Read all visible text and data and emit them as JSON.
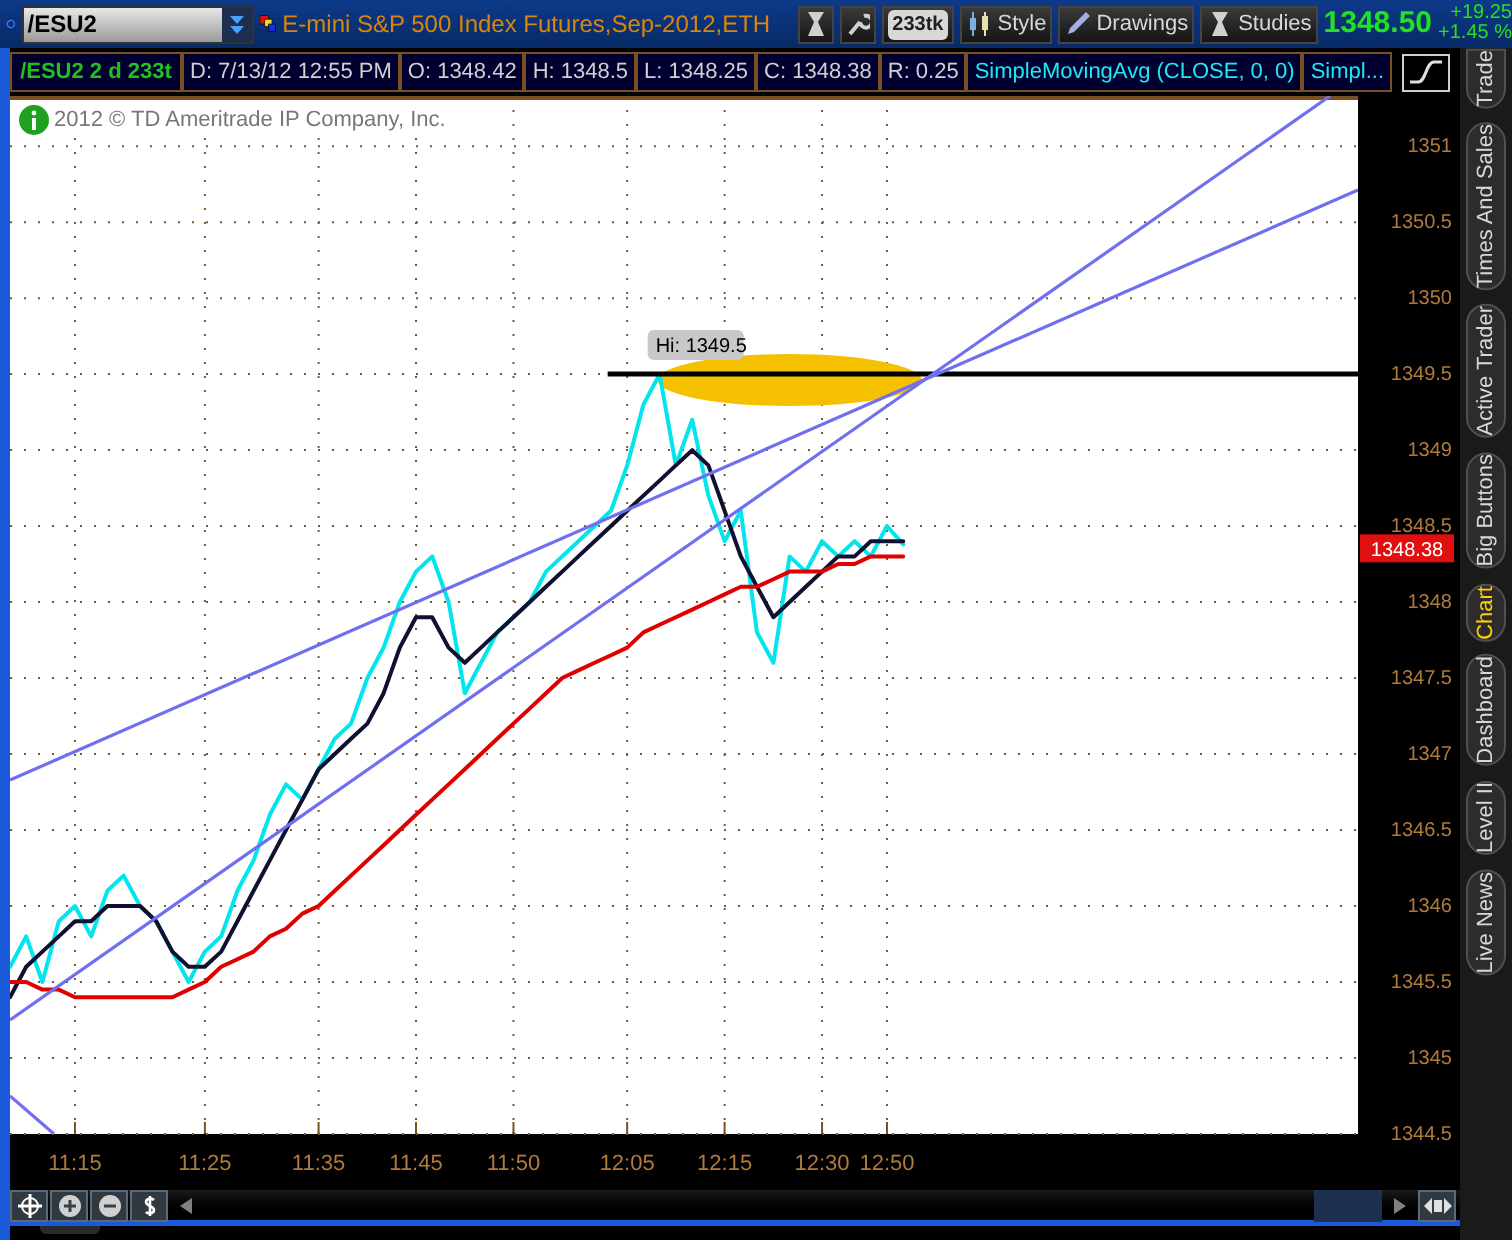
{
  "header": {
    "symbol": "/ESU2",
    "title": "E-mini S&P 500 Index Futures,Sep-2012,ETH",
    "aggregation": "233tk",
    "buttons": [
      "Style",
      "Drawings",
      "Studies"
    ],
    "last": "1348.50",
    "change": "+19.25",
    "change_pct": "+1.45 %"
  },
  "info_bar": {
    "symbol_period": "/ESU2 2 d 233t",
    "fields": [
      "D: 7/13/12 12:55 PM",
      "O: 1348.42",
      "H: 1348.5",
      "L: 1348.25",
      "C: 1348.38",
      "R: 0.25"
    ],
    "studies": [
      "SimpleMovingAvg (CLOSE, 0, 0)",
      "Simpl..."
    ]
  },
  "chart": {
    "copyright": "2012 © TD Ameritrade IP Company, Inc.",
    "chart_data": {
      "type": "line",
      "categories": [
        null,
        null,
        null,
        null,
        "11:15",
        null,
        null,
        null,
        null,
        null,
        null,
        null,
        "11:25",
        null,
        null,
        null,
        null,
        null,
        null,
        "11:35",
        null,
        null,
        null,
        null,
        null,
        "11:45",
        null,
        null,
        null,
        null,
        null,
        "11:50",
        null,
        null,
        null,
        null,
        null,
        null,
        "12:05",
        null,
        null,
        null,
        null,
        null,
        "12:15",
        null,
        null,
        null,
        null,
        null,
        "12:30",
        null,
        null,
        null,
        "12:50",
        null
      ],
      "ylim": [
        1344.5,
        1351.33
      ],
      "yticks": [
        1344.5,
        1345,
        1345.5,
        1346,
        1346.5,
        1347,
        1347.5,
        1348,
        1348.5,
        1349,
        1349.5,
        1350,
        1350.5,
        1351
      ],
      "series": [
        {
          "color": "#00e5ee",
          "values": [
            1345.6,
            1345.8,
            1345.5,
            1345.9,
            1346.0,
            1345.8,
            1346.1,
            1346.2,
            1346.0,
            1345.9,
            1345.7,
            1345.5,
            1345.7,
            1345.8,
            1346.1,
            1346.3,
            1346.6,
            1346.8,
            1346.7,
            1346.9,
            1347.1,
            1347.2,
            1347.5,
            1347.7,
            1348.0,
            1348.2,
            1348.3,
            1348.0,
            1347.4,
            1347.6,
            1347.8,
            1347.9,
            1348.0,
            1348.2,
            1348.3,
            1348.4,
            1348.5,
            1348.6,
            1348.9,
            1349.3,
            1349.5,
            1348.9,
            1349.2,
            1348.7,
            1348.4,
            1348.6,
            1347.8,
            1347.6,
            1348.3,
            1348.2,
            1348.4,
            1348.3,
            1348.4,
            1348.3,
            1348.5,
            1348.38
          ]
        },
        {
          "color": "#101030",
          "values": [
            1345.4,
            1345.6,
            1345.7,
            1345.8,
            1345.9,
            1345.9,
            1346.0,
            1346.0,
            1346.0,
            1345.9,
            1345.7,
            1345.6,
            1345.6,
            1345.7,
            1345.9,
            1346.1,
            1346.3,
            1346.5,
            1346.7,
            1346.9,
            1347.0,
            1347.1,
            1347.2,
            1347.4,
            1347.7,
            1347.9,
            1347.9,
            1347.7,
            1347.6,
            1347.7,
            1347.8,
            1347.9,
            1348.0,
            1348.1,
            1348.2,
            1348.3,
            1348.4,
            1348.5,
            1348.6,
            1348.7,
            1348.8,
            1348.9,
            1349.0,
            1348.9,
            1348.6,
            1348.3,
            1348.1,
            1347.9,
            1348.0,
            1348.1,
            1348.2,
            1348.3,
            1348.3,
            1348.4,
            1348.4,
            1348.4
          ]
        },
        {
          "color": "#e00000",
          "values": [
            1345.5,
            1345.5,
            1345.45,
            1345.45,
            1345.4,
            1345.4,
            1345.4,
            1345.4,
            1345.4,
            1345.4,
            1345.4,
            1345.45,
            1345.5,
            1345.6,
            1345.65,
            1345.7,
            1345.8,
            1345.85,
            1345.95,
            1346.0,
            1346.1,
            1346.2,
            1346.3,
            1346.4,
            1346.5,
            1346.6,
            1346.7,
            1346.8,
            1346.9,
            1347.0,
            1347.1,
            1347.2,
            1347.3,
            1347.4,
            1347.5,
            1347.55,
            1347.6,
            1347.65,
            1347.7,
            1347.8,
            1347.85,
            1347.9,
            1347.95,
            1348.0,
            1348.05,
            1348.1,
            1348.1,
            1348.15,
            1348.2,
            1348.2,
            1348.2,
            1348.25,
            1348.25,
            1348.3,
            1348.3,
            1348.3
          ]
        }
      ],
      "grid": true,
      "annotations": [
        "Hi: 1349.5",
        "1348.38"
      ]
    }
  },
  "sidebar": {
    "tabs": [
      {
        "label": "Trade",
        "selected": false
      },
      {
        "label": "Times And Sales",
        "selected": false
      },
      {
        "label": "Active Trader",
        "selected": false
      },
      {
        "label": "Big Buttons",
        "selected": false
      },
      {
        "label": "Chart",
        "selected": true
      },
      {
        "label": "Dashboard",
        "selected": false
      },
      {
        "label": "Level II",
        "selected": false
      },
      {
        "label": "Live News",
        "selected": false
      }
    ]
  }
}
